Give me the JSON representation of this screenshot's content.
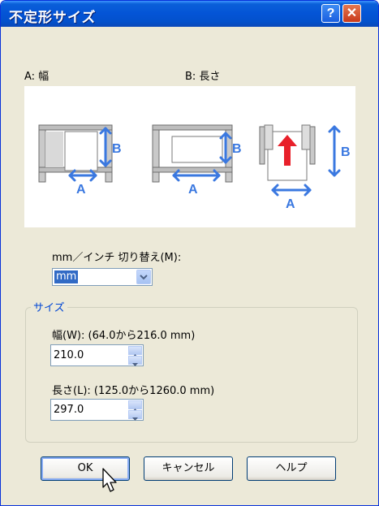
{
  "window": {
    "title": "不定形サイズ"
  },
  "titlebar": {
    "help_glyph": "?",
    "close_glyph": "✕"
  },
  "illustration": {
    "label_a": "A: 幅",
    "label_b": "B: 長さ",
    "marker_a": "A",
    "marker_b": "B",
    "accent_color": "#3a78e0",
    "arrow_color": "#e8202a"
  },
  "unit": {
    "label": "mm／インチ 切り替え(M):",
    "value": "mm"
  },
  "size_group": {
    "title": "サイズ",
    "width_label": "幅(W): (64.0から216.0 mm)",
    "width_value": "210.0",
    "length_label": "長さ(L): (125.0から1260.0 mm)",
    "length_value": "297.0"
  },
  "buttons": {
    "ok": "OK",
    "cancel": "キャンセル",
    "help": "ヘルプ"
  }
}
